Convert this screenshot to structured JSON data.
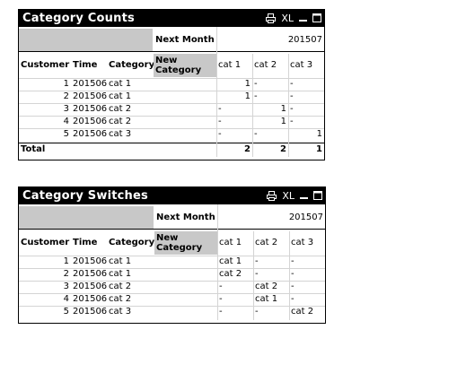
{
  "objects": [
    {
      "title": "Category Counts",
      "icons": {
        "xl": "XL",
        "print": "printer-icon",
        "minimize": "minimize-icon",
        "maximize": "maximize-icon"
      },
      "pivot_label": "Next Month",
      "pivot_value": "201507",
      "headers": {
        "customer": "Customer",
        "time": "Time",
        "category": "Category",
        "new_category": "New Category"
      },
      "value_columns": [
        "cat 1",
        "cat 2",
        "cat 3"
      ],
      "rows": [
        {
          "customer": "1",
          "time": "201506",
          "category": "cat 1",
          "values": [
            "1",
            "-",
            "-"
          ]
        },
        {
          "customer": "2",
          "time": "201506",
          "category": "cat 1",
          "values": [
            "1",
            "-",
            "-"
          ]
        },
        {
          "customer": "3",
          "time": "201506",
          "category": "cat 2",
          "values": [
            "-",
            "1",
            "-"
          ]
        },
        {
          "customer": "4",
          "time": "201506",
          "category": "cat 2",
          "values": [
            "-",
            "1",
            "-"
          ]
        },
        {
          "customer": "5",
          "time": "201506",
          "category": "cat 3",
          "values": [
            "-",
            "-",
            "1"
          ]
        }
      ],
      "total": {
        "label": "Total",
        "values": [
          "2",
          "2",
          "1"
        ]
      }
    },
    {
      "title": "Category Switches",
      "icons": {
        "xl": "XL",
        "print": "printer-icon",
        "minimize": "minimize-icon",
        "maximize": "maximize-icon"
      },
      "pivot_label": "Next Month",
      "pivot_value": "201507",
      "headers": {
        "customer": "Customer",
        "time": "Time",
        "category": "Category",
        "new_category": "New Category"
      },
      "value_columns": [
        "cat 1",
        "cat 2",
        "cat 3"
      ],
      "rows": [
        {
          "customer": "1",
          "time": "201506",
          "category": "cat 1",
          "values": [
            "cat 1",
            "-",
            "-"
          ]
        },
        {
          "customer": "2",
          "time": "201506",
          "category": "cat 1",
          "values": [
            "cat 2",
            "-",
            "-"
          ]
        },
        {
          "customer": "3",
          "time": "201506",
          "category": "cat 2",
          "values": [
            "-",
            "cat 2",
            "-"
          ]
        },
        {
          "customer": "4",
          "time": "201506",
          "category": "cat 2",
          "values": [
            "-",
            "cat 1",
            "-"
          ]
        },
        {
          "customer": "5",
          "time": "201506",
          "category": "cat 3",
          "values": [
            "-",
            "-",
            "cat 2"
          ]
        }
      ]
    }
  ]
}
